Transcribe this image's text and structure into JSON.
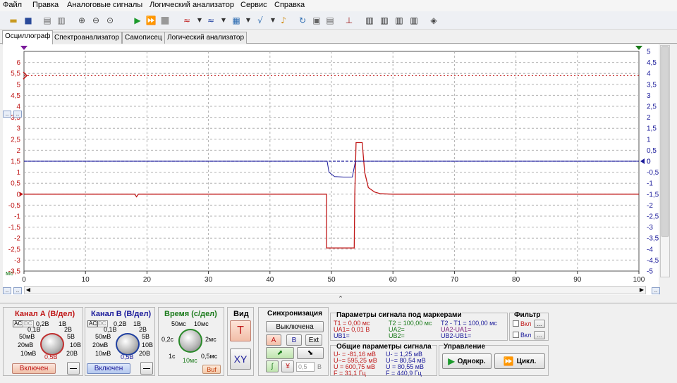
{
  "menu": [
    "Файл",
    "Правка",
    "Аналоговые сигналы",
    "Логический анализатор",
    "Сервис",
    "Справка"
  ],
  "tabs": [
    "Осциллограф",
    "Спектроанализатор",
    "Самописец",
    "Логический анализатор"
  ],
  "colors": {
    "channel_a": "#c01818",
    "channel_b": "#1a1a9a",
    "time": "#1a7a1a",
    "grid": "#b0b0b0"
  },
  "plot": {
    "x_unit": "мс",
    "x_ticks": [
      "0",
      "10",
      "20",
      "30",
      "40",
      "50",
      "60",
      "70",
      "80",
      "90",
      "100"
    ],
    "left_ticks": [
      "6",
      "5,5",
      "5",
      "4,5",
      "4",
      "3,5",
      "3",
      "2,5",
      "2",
      "1,5",
      "1",
      "0,5",
      "0",
      "-0,5",
      "-1",
      "-1,5",
      "-2",
      "-2,5",
      "-3",
      "-3,5"
    ],
    "right_ticks": [
      "5",
      "4,5",
      "4",
      "3,5",
      "3",
      "2,5",
      "2",
      "1,5",
      "1",
      "0,5",
      "0",
      "-0,5",
      "-1",
      "-1,5",
      "-2",
      "-2,5",
      "-3",
      "-3,5",
      "-4",
      "-4,5",
      "-5"
    ],
    "marker_label": "0"
  },
  "chart_data": {
    "type": "line",
    "x_label": "мс",
    "x_range": [
      0,
      100
    ],
    "y_left_range": [
      -3.5,
      6.5
    ],
    "y_right_range": [
      -5,
      5
    ],
    "series": [
      {
        "x": [
          0,
          18,
          18.3,
          18.6,
          49.2,
          49.2,
          53.7,
          53.8,
          54,
          54.2,
          54.3,
          55,
          55.4,
          56,
          57,
          58,
          60,
          100
        ],
        "y": [
          0,
          0,
          -0.12,
          0,
          0,
          -2.45,
          -2.45,
          0,
          2.35,
          2.35,
          2.35,
          2.35,
          1.0,
          0.3,
          0.1,
          0.02,
          0,
          0
        ]
      },
      {
        "x": [
          0,
          49.3,
          49.6,
          50.5,
          52,
          53.4,
          53.9,
          54.5,
          100
        ],
        "y": [
          0,
          0,
          -0.5,
          -0.7,
          -0.72,
          -0.72,
          0,
          0,
          0
        ]
      }
    ]
  },
  "channel_a": {
    "title": "Канал А (В/дел)",
    "scale": [
      "0,2В",
      "1В",
      "2В",
      "5В",
      "10В",
      "20В",
      "0,5В",
      "10мВ",
      "20мВ",
      "50мВ",
      "0,1В"
    ],
    "button": "Включен",
    "minus": "—",
    "mode_ac": "AC"
  },
  "channel_b": {
    "title": "Канал В (В/дел)",
    "scale": [
      "0,2В",
      "1В",
      "2В",
      "5В",
      "10В",
      "20В",
      "0,5В",
      "10мВ",
      "20мВ",
      "50мВ",
      "0,1В"
    ],
    "button": "Включен",
    "minus": "—",
    "mode_ac": "AC"
  },
  "time_panel": {
    "title": "Время (с/дел)",
    "scale": [
      "50мс",
      "10мс",
      "2мс",
      "0,5мс",
      "10мс",
      "1с",
      "0,2с"
    ],
    "buf": "Buf"
  },
  "view_panel": {
    "title": "Вид",
    "t": "T",
    "xy": "XY"
  },
  "sync_panel": {
    "title": "Синхронизация",
    "state": "Выключена",
    "ch_a": "A",
    "ch_b": "B",
    "ext": "Ext",
    "level": "0,5",
    "unit": "В"
  },
  "markers_panel": {
    "title": "Параметры сигнала под маркерами",
    "col1": [
      "T1 = 0,00 мс",
      "UA1= 0,01 В",
      "UB1="
    ],
    "col2": [
      "T2 = 100,00 мс",
      "UA2=",
      "UB2="
    ],
    "col3": [
      "T2 - T1 = 100,00 мс",
      "UA2-UA1=",
      "UB2-UB1="
    ]
  },
  "filter_panel": {
    "title": "Фильтр",
    "on1": "Вкл",
    "on2": "Вкл",
    "more": "..."
  },
  "general_panel": {
    "title": "Общие параметры сигнала",
    "col1": [
      "U- = -81,16 мВ",
      "U~= 595,25 мВ",
      "U = 600,75 мВ",
      "F = 31,1 Гц"
    ],
    "col2": [
      "U- = 1,25 мВ",
      "U~= 80,54 мВ",
      "U = 80,55 мВ",
      "F = 440,9 Гц"
    ]
  },
  "control_panel": {
    "title": "Управление",
    "single": "Однокр.",
    "cycle": "Цикл."
  }
}
